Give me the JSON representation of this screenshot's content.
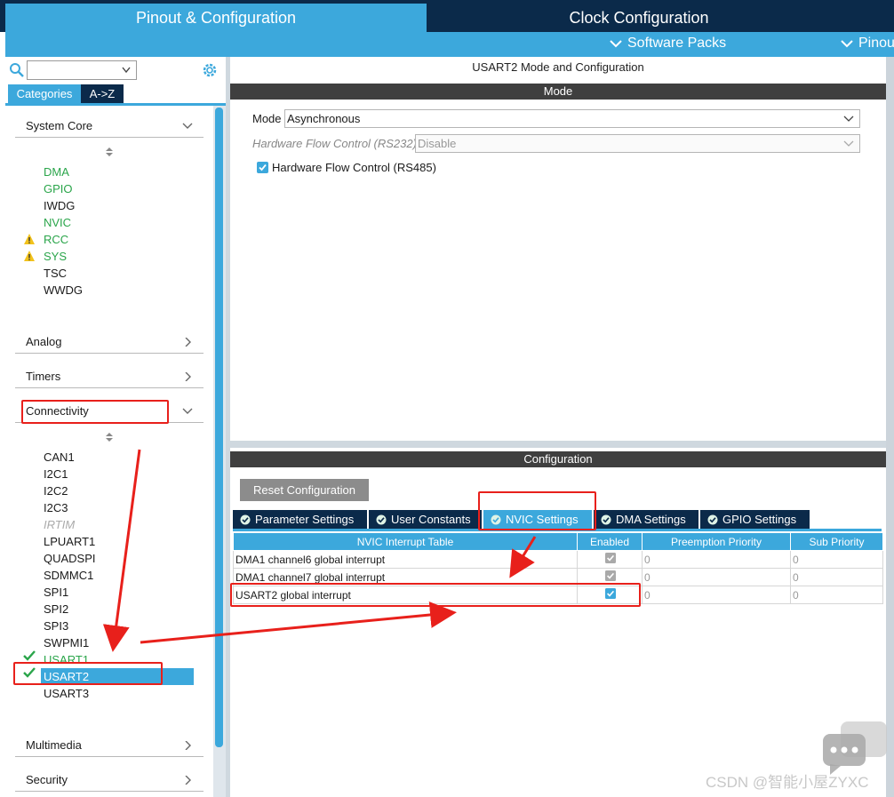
{
  "top_tabs": {
    "pinout": "Pinout & Configuration",
    "clock": "Clock Configuration"
  },
  "subbar": {
    "software_packs": "Software Packs",
    "pinout": "Pinou"
  },
  "left": {
    "tabs": {
      "categories": "Categories",
      "az": "A->Z"
    },
    "groups": {
      "system_core": "System Core",
      "analog": "Analog",
      "timers": "Timers",
      "connectivity": "Connectivity",
      "multimedia": "Multimedia",
      "security": "Security"
    },
    "system_core_items": [
      "DMA",
      "GPIO",
      "IWDG",
      "NVIC",
      "RCC",
      "SYS",
      "TSC",
      "WWDG"
    ],
    "connectivity_items": [
      "CAN1",
      "I2C1",
      "I2C2",
      "I2C3",
      "IRTIM",
      "LPUART1",
      "QUADSPI",
      "SDMMC1",
      "SPI1",
      "SPI2",
      "SPI3",
      "SWPMI1",
      "USART1",
      "USART2",
      "USART3"
    ]
  },
  "right": {
    "title": "USART2 Mode and Configuration",
    "mode_band": "Mode",
    "mode_label": "Mode",
    "mode_value": "Asynchronous",
    "hfc232_label": "Hardware Flow Control (RS232)",
    "hfc232_value": "Disable",
    "hfc485_label": "Hardware Flow Control (RS485)",
    "hfc485_checked": true,
    "config_band": "Configuration",
    "reset_button": "Reset Configuration",
    "tabs": [
      "Parameter Settings",
      "User Constants",
      "NVIC Settings",
      "DMA Settings",
      "GPIO Settings"
    ],
    "active_tab": "NVIC Settings",
    "table": {
      "headers": [
        "NVIC Interrupt Table",
        "Enabled",
        "Preemption Priority",
        "Sub Priority"
      ],
      "rows": [
        {
          "name": "DMA1 channel6 global interrupt",
          "enabled": true,
          "preemption": "0",
          "sub": "0"
        },
        {
          "name": "DMA1 channel7 global interrupt",
          "enabled": true,
          "preemption": "0",
          "sub": "0"
        },
        {
          "name": "USART2 global interrupt",
          "enabled": true,
          "preemption": "0",
          "sub": "0"
        }
      ]
    }
  },
  "watermark": "CSDN @智能小屋ZYXC",
  "colors": {
    "accent_blue": "#3ca8dc",
    "navy": "#0b2a4a",
    "green": "#2aa54a",
    "warning": "#f2c21b",
    "annotation_red": "#e8201b"
  },
  "icons": [
    "search-icon",
    "gear-icon",
    "chevron-down-icon",
    "chevron-right-icon",
    "warning-icon",
    "check-icon",
    "sort-icon",
    "chat-icon"
  ]
}
